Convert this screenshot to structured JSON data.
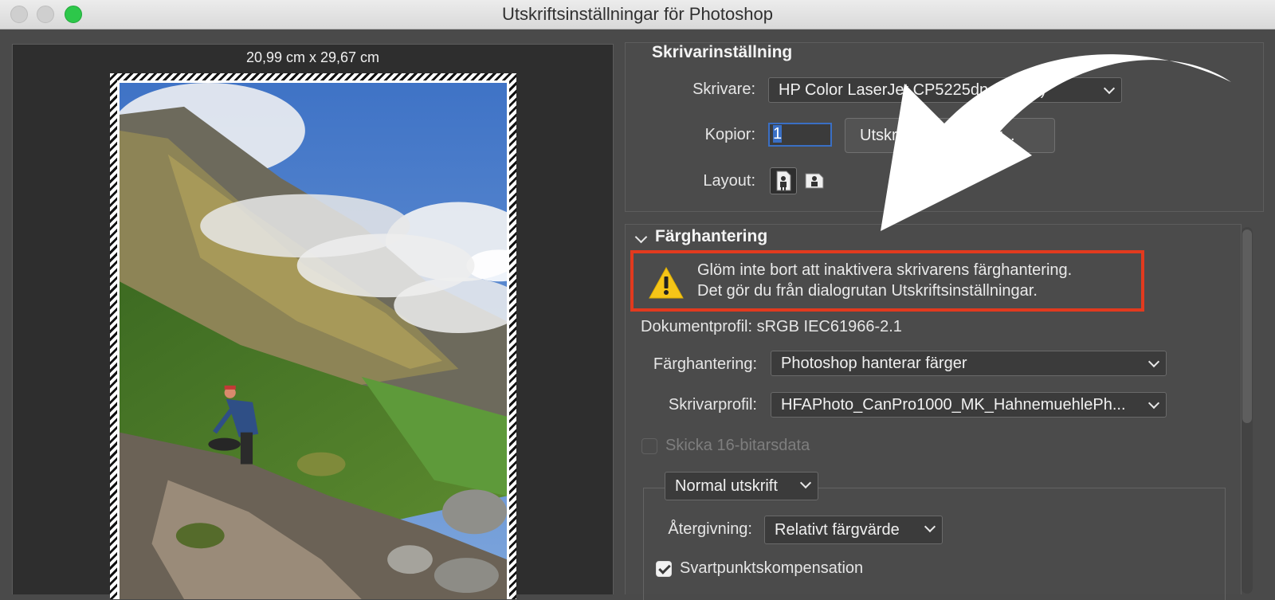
{
  "window": {
    "title": "Utskriftsinställningar för Photoshop"
  },
  "preview": {
    "paper_size": "20,99 cm x 29,67 cm"
  },
  "printer_settings": {
    "section_title": "Skrivarinställning",
    "printer_label": "Skrivare:",
    "printer_value": "HP Color LaserJet CP5225dn (…239)",
    "copies_label": "Kopior:",
    "copies_value": "1",
    "print_settings_button": "Utskriftsinställningar...",
    "layout_label": "Layout:",
    "layout_icons": [
      "portrait-layout-icon",
      "landscape-layout-icon"
    ]
  },
  "color_management": {
    "section_title": "Färghantering",
    "warning_icon": "warning-icon",
    "warning_line1": "Glöm inte bort att inaktivera skrivarens färghantering.",
    "warning_line2": "Det gör du från dialogrutan Utskriftsinställningar.",
    "document_profile": "Dokumentprofil: sRGB IEC61966-2.1",
    "color_handling_label": "Färghantering:",
    "color_handling_value": "Photoshop hanterar färger",
    "printer_profile_label": "Skrivarprofil:",
    "printer_profile_value": "HFAPhoto_CanPro1000_MK_HahnemuehlePh...",
    "send_16bit_label": "Skicka 16-bitarsdata",
    "send_16bit_checked": false,
    "print_mode_value": "Normal utskrift",
    "rendering_label": "Återgivning:",
    "rendering_value": "Relativt färgvärde",
    "black_point_label": "Svartpunktskompensation",
    "black_point_checked": true
  },
  "colors": {
    "highlight_border": "#e23a1e",
    "accent_blue": "#3a6fc4",
    "warning_yellow": "#f5c518"
  }
}
